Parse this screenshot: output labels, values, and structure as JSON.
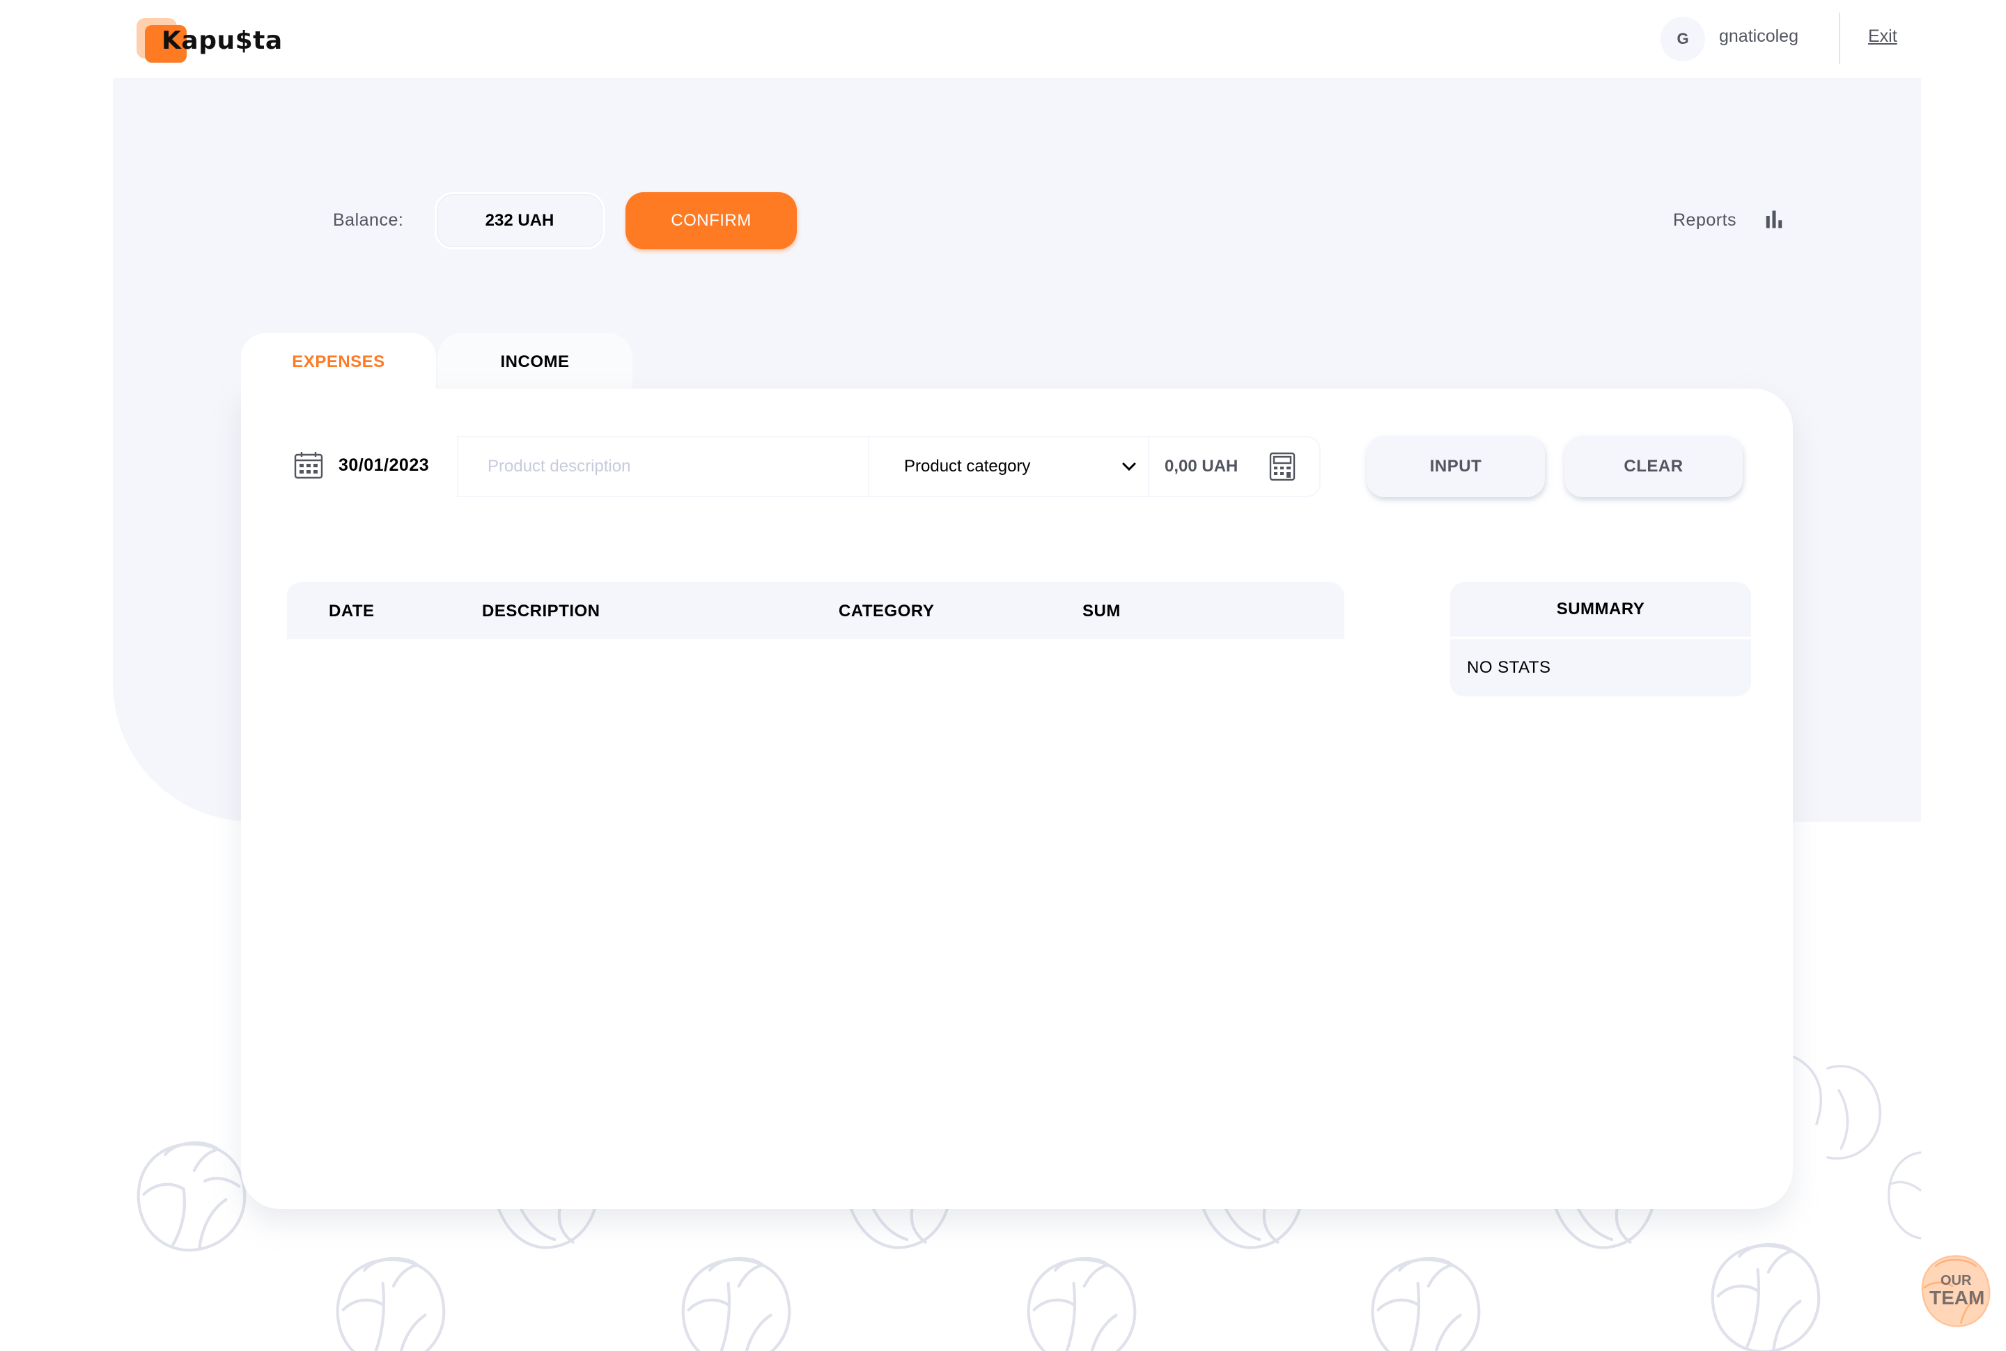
{
  "header": {
    "logo_text": "Kapu$ta",
    "avatar_letter": "G",
    "username": "gnaticoleg",
    "exit_label": "Exit"
  },
  "balance": {
    "label": "Balance:",
    "value": "232 UAH",
    "confirm_label": "CONFIRM"
  },
  "reports": {
    "label": "Reports",
    "icon": "bar-chart-icon"
  },
  "tabs": [
    {
      "label": "EXPENSES",
      "active": true
    },
    {
      "label": "INCOME",
      "active": false
    }
  ],
  "form": {
    "date": "30/01/2023",
    "date_icon": "calendar-icon",
    "description_placeholder": "Product description",
    "category_value": "Product category",
    "sum_placeholder": "0,00 UAH",
    "sum_icon": "calculator-icon",
    "input_label": "INPUT",
    "clear_label": "CLEAR"
  },
  "table": {
    "columns": [
      "DATE",
      "DESCRIPTION",
      "CATEGORY",
      "SUM"
    ],
    "rows": []
  },
  "summary": {
    "title": "SUMMARY",
    "empty_text": "NO STATS"
  },
  "team_badge": {
    "line1": "OUR",
    "line2": "TEAM"
  },
  "colors": {
    "accent": "#FE7A23",
    "background_panel": "#F5F6FB",
    "text_muted": "#52555F",
    "placeholder": "#C7CCDC"
  }
}
